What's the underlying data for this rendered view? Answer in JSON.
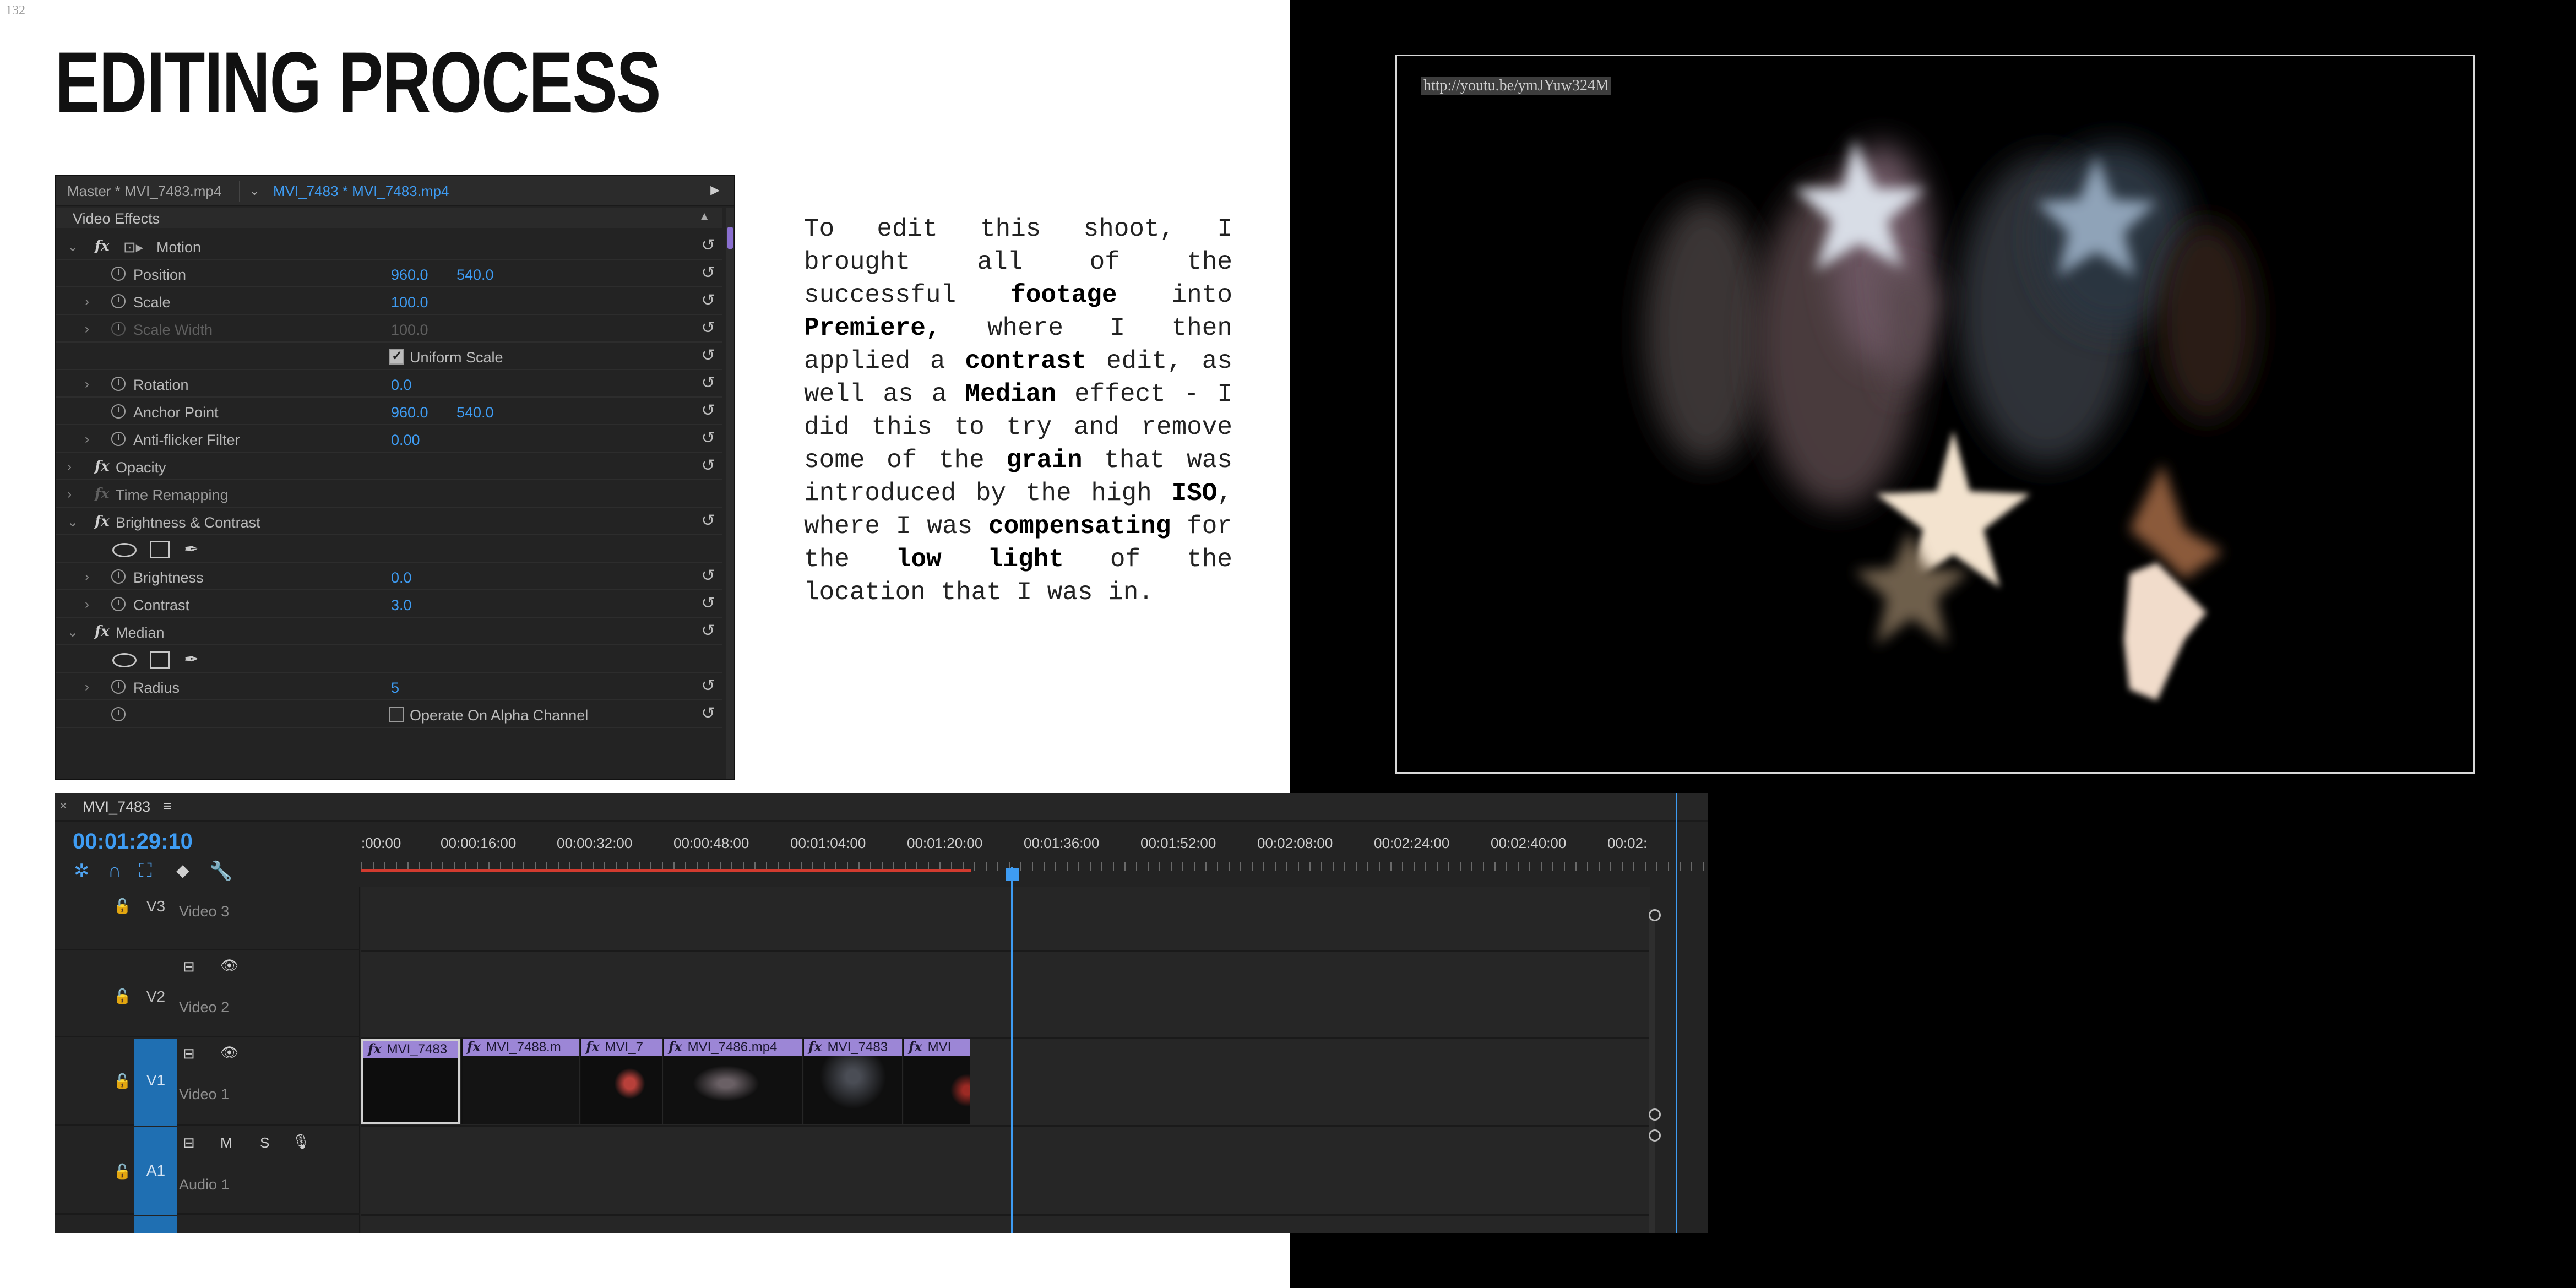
{
  "page_number": "132",
  "title": "EDITING PROCESS",
  "effect_controls": {
    "tab_master": "Master * MVI_7483.mp4",
    "tab_active": "MVI_7483 * MVI_7483.mp4",
    "section": "Video Effects",
    "rows": {
      "motion": "Motion",
      "position": "Position",
      "position_x": "960.0",
      "position_y": "540.0",
      "scale": "Scale",
      "scale_val": "100.0",
      "scale_width": "Scale Width",
      "scale_width_val": "100.0",
      "uniform_scale": "Uniform Scale",
      "rotation": "Rotation",
      "rotation_val": "0.0",
      "anchor_point": "Anchor Point",
      "anchor_x": "960.0",
      "anchor_y": "540.0",
      "anti_flicker": "Anti-flicker Filter",
      "anti_flicker_val": "0.00",
      "opacity": "Opacity",
      "time_remapping": "Time Remapping",
      "brightness_contrast": "Brightness & Contrast",
      "brightness": "Brightness",
      "brightness_val": "0.0",
      "contrast": "Contrast",
      "contrast_val": "3.0",
      "median": "Median",
      "radius": "Radius",
      "radius_val": "5",
      "alpha": "Operate On Alpha Channel"
    }
  },
  "body_text": {
    "p1": "To edit this shoot, I brought all of the successful ",
    "b1": "footage",
    "p2": " into ",
    "b2": "Premiere,",
    "p3": " where I then applied a ",
    "b3": "contrast",
    "p4": " edit, as well as a ",
    "b4": "Median",
    "p5": " effect - I did this to try and remove some of the ",
    "b5": "grain",
    "p6": " that was introduced by the high ",
    "b6": "ISO",
    "p7": ", where I was ",
    "b7": "compensating",
    "p8": " for the ",
    "b8": "low light",
    "p9": " of the location that I was in."
  },
  "video": {
    "url": "http://youtu.be/ymJYuw324M"
  },
  "timeline": {
    "close": "×",
    "sequence_name": "MVI_7483",
    "menu_icon": "≡",
    "timecode": "00:01:29:10",
    "ruler_labels": [
      ":00:00",
      "00:00:16:00",
      "00:00:32:00",
      "00:00:48:00",
      "00:01:04:00",
      "00:01:20:00",
      "00:01:36:00",
      "00:01:52:00",
      "00:02:08:00",
      "00:02:24:00",
      "00:02:40:00",
      "00:02:"
    ],
    "tracks": {
      "v3_id": "V3",
      "v3_name": "Video 3",
      "v2_id": "V2",
      "v2_name": "Video 2",
      "v1_id": "V1",
      "v1_name": "Video 1",
      "a1_id": "A1",
      "a1_name": "Audio 1",
      "m": "M",
      "s": "S"
    },
    "clips": [
      "MVI_7483",
      "MVI_7488.m",
      "MVI_7",
      "MVI_7486.mp4",
      "MVI_7483",
      "MVI"
    ],
    "clip_fx": "fx"
  }
}
